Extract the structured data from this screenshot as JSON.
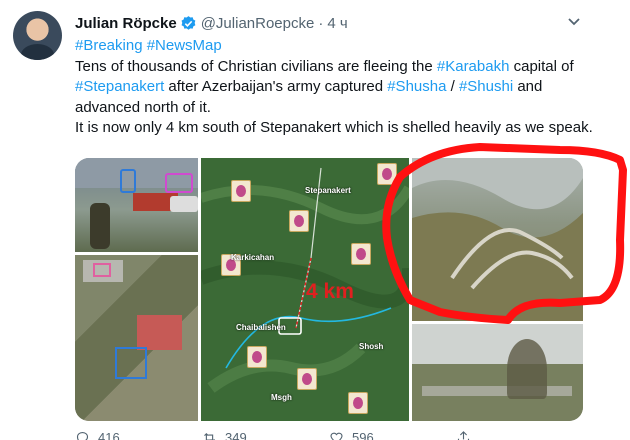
{
  "tweet": {
    "author_name": "Julian Röpcke",
    "handle": "@JulianRoepcke",
    "separator": "·",
    "time": "4 ч",
    "hashtags_line": "#Breaking #NewsMap",
    "body_parts": [
      {
        "text": "Tens of thousands of Christian civilians are fleeing the ",
        "tag": false
      },
      {
        "text": "#Karabakh",
        "tag": true
      },
      {
        "text": " capital of ",
        "tag": false
      },
      {
        "text": "#Stepanakert",
        "tag": true
      },
      {
        "text": " after Azerbaijan's army captured ",
        "tag": false
      },
      {
        "text": "#Shusha",
        "tag": true
      },
      {
        "text": " / ",
        "tag": false
      },
      {
        "text": "#Shushi",
        "tag": true
      },
      {
        "text": " and advanced north of it.",
        "tag": false
      }
    ],
    "body_line2": "It is now only 4 km south of Stepanakert which is shelled heavily as we speak."
  },
  "media": {
    "map_labels": {
      "stepanakert": "Stepanakert",
      "karkicahan": "Karkicahan",
      "chaibalishen": "Chaibalishen",
      "shosh": "Shosh",
      "msgh": "Msgh",
      "distance": "4 km"
    }
  },
  "actions": {
    "reply_count": "416",
    "retweet_count": "349",
    "like_count": "596"
  },
  "colors": {
    "link": "#1d9bf0",
    "secondary": "#536471",
    "highlight": "#e02020"
  },
  "icons": [
    "verified-badge-icon",
    "more-options-icon",
    "reply-icon",
    "retweet-icon",
    "like-icon",
    "share-icon"
  ]
}
